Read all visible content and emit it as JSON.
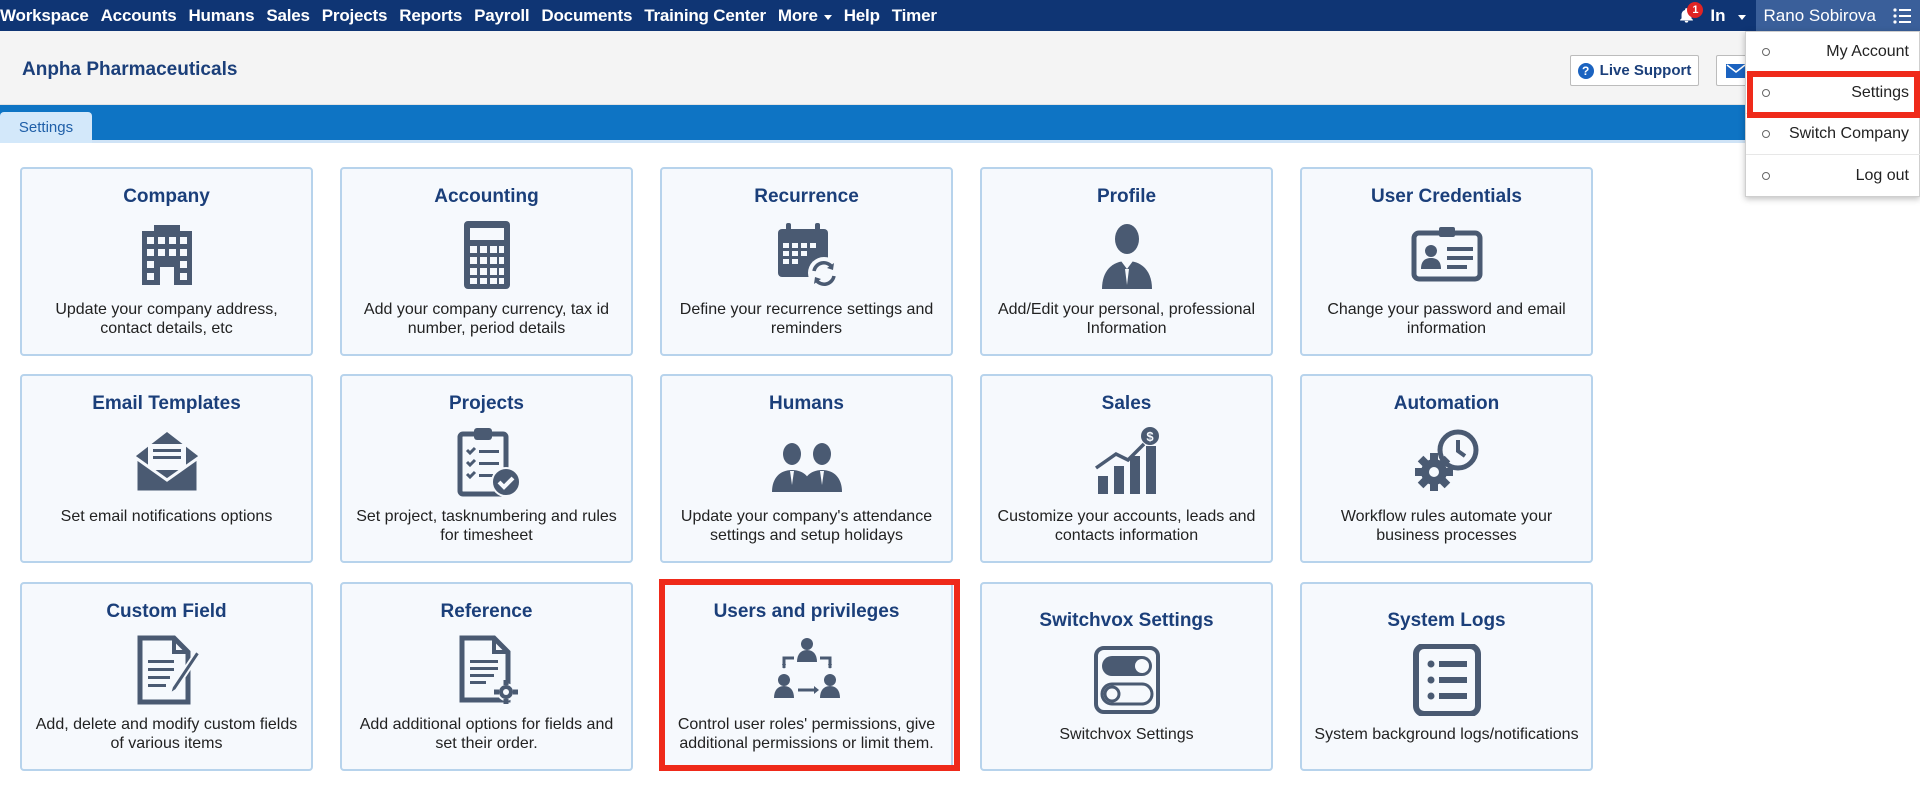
{
  "nav": {
    "items": [
      {
        "label": "Workspace"
      },
      {
        "label": "Accounts"
      },
      {
        "label": "Humans"
      },
      {
        "label": "Sales"
      },
      {
        "label": "Projects"
      },
      {
        "label": "Reports"
      },
      {
        "label": "Payroll"
      },
      {
        "label": "Documents"
      },
      {
        "label": "Training Center"
      },
      {
        "label": "More"
      },
      {
        "label": "Help"
      },
      {
        "label": "Timer"
      }
    ],
    "notification_count": "1",
    "in_label": "In",
    "user_name": "Rano Sobirova"
  },
  "header": {
    "company": "Anpha Pharmaceuticals",
    "live_support": "Live Support"
  },
  "tabs": [
    {
      "label": "Settings"
    }
  ],
  "dropdown": {
    "items": [
      {
        "label": "My Account"
      },
      {
        "label": "Settings"
      },
      {
        "label": "Switch Company"
      },
      {
        "label": "Log out"
      }
    ]
  },
  "cards": [
    {
      "title": "Company",
      "desc": "Update your company address, contact details, etc",
      "icon": "building-icon"
    },
    {
      "title": "Accounting",
      "desc": "Add your company currency, tax id number, period details",
      "icon": "calculator-icon"
    },
    {
      "title": "Recurrence",
      "desc": "Define your recurrence settings and reminders",
      "icon": "calendar-refresh-icon"
    },
    {
      "title": "Profile",
      "desc": "Add/Edit your personal, professional Information",
      "icon": "person-icon"
    },
    {
      "title": "User Credentials",
      "desc": "Change your password and email information",
      "icon": "id-card-icon"
    },
    {
      "title": "Email Templates",
      "desc": "Set email notifications options",
      "icon": "envelope-icon"
    },
    {
      "title": "Projects",
      "desc": "Set project, tasknumbering and rules for timesheet",
      "icon": "clipboard-check-icon"
    },
    {
      "title": "Humans",
      "desc": "Update your company's attendance settings and setup holidays",
      "icon": "people-icon"
    },
    {
      "title": "Sales",
      "desc": "Customize your accounts, leads and contacts information",
      "icon": "sales-chart-icon"
    },
    {
      "title": "Automation",
      "desc": "Workflow rules automate your business processes",
      "icon": "gear-clock-icon"
    },
    {
      "title": "Custom Field",
      "desc": "Add, delete and modify custom fields of various items",
      "icon": "document-pen-icon"
    },
    {
      "title": "Reference",
      "desc": "Add additional options for fields and set their order.",
      "icon": "document-gear-icon"
    },
    {
      "title": "Users and privileges",
      "desc": "Control user roles' permissions, give additional permissions or limit them.",
      "icon": "user-hierarchy-icon"
    },
    {
      "title": "Switchvox Settings",
      "desc": "Switchvox Settings",
      "icon": "toggle-switch-icon"
    },
    {
      "title": "System Logs",
      "desc": "System background logs/notifications",
      "icon": "list-log-icon"
    }
  ]
}
